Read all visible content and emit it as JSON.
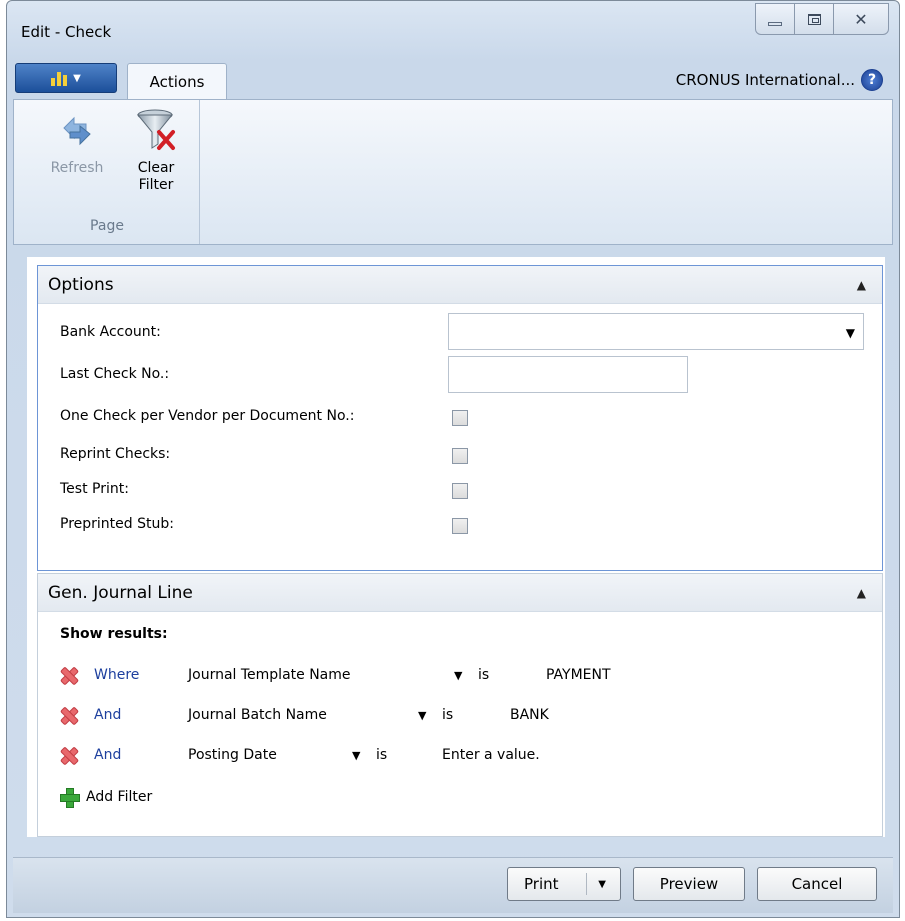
{
  "window": {
    "title": "Edit - Check"
  },
  "ribbon": {
    "tabs": [
      {
        "label": "Actions"
      }
    ],
    "company": "CRONUS International...",
    "groups": [
      {
        "label": "Page",
        "buttons": [
          {
            "label_line1": "Refresh",
            "label_line2": "",
            "enabled": false,
            "icon": "refresh-icon"
          },
          {
            "label_line1": "Clear",
            "label_line2": "Filter",
            "enabled": true,
            "icon": "clear-filter-icon"
          }
        ]
      }
    ]
  },
  "options": {
    "title": "Options",
    "fields": {
      "bank_account": {
        "label": "Bank Account:",
        "value": ""
      },
      "last_check_no": {
        "label": "Last Check No.:",
        "value": ""
      },
      "one_check_per_vendor": {
        "label": "One Check per Vendor per Document No.:",
        "checked": false
      },
      "reprint_checks": {
        "label": "Reprint Checks:",
        "checked": false
      },
      "test_print": {
        "label": "Test Print:",
        "checked": false
      },
      "preprinted_stub": {
        "label": "Preprinted Stub:",
        "checked": false
      }
    }
  },
  "gen_journal_line": {
    "title": "Gen. Journal Line",
    "show_results": "Show results:",
    "filters": [
      {
        "conj": "Where",
        "field": "Journal Template Name",
        "op": "is",
        "value": "PAYMENT"
      },
      {
        "conj": "And",
        "field": "Journal Batch Name",
        "op": "is",
        "value": "BANK"
      },
      {
        "conj": "And",
        "field": "Posting Date",
        "op": "is",
        "value": "Enter a value."
      }
    ],
    "add_filter": "Add Filter"
  },
  "footer": {
    "print": "Print",
    "preview": "Preview",
    "cancel": "Cancel"
  },
  "colors": {
    "link_blue": "#1d3f9e",
    "panel_border_active": "#6d95d6",
    "app_menu_blue": "#1c4f9a"
  }
}
